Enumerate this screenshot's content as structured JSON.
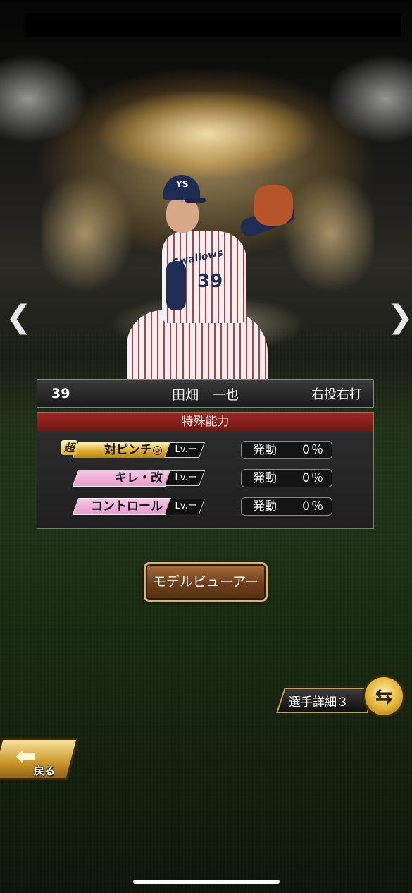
{
  "player": {
    "number": "39",
    "name": "田畑　一也",
    "hand": "右投右打",
    "cap_logo": "YS",
    "jersey_text": "Swallows",
    "jersey_number": "39"
  },
  "abilities": {
    "header": "特殊能力",
    "items": [
      {
        "name": "対ピンチ◎",
        "badge": "超",
        "style": "gold",
        "level": "Lv.ー",
        "activation_label": "発動",
        "activation_value": "0％"
      },
      {
        "name": "キレ・改",
        "badge": "",
        "style": "pink",
        "level": "Lv.ー",
        "activation_label": "発動",
        "activation_value": "0％"
      },
      {
        "name": "コントロール",
        "badge": "",
        "style": "pink",
        "level": "Lv.ー",
        "activation_label": "発動",
        "activation_value": "0％"
      }
    ]
  },
  "buttons": {
    "model_viewer": "モデルビューアー",
    "player_detail": "選手詳細３",
    "back": "戻る"
  },
  "icons": {
    "prev": "chevron-left-icon",
    "next": "chevron-right-icon",
    "cycle": "cycle-icon",
    "back_arrow": "back-arrow-icon"
  },
  "glyphs": {
    "prev": "❮",
    "next": "❯",
    "cycle": "⇆",
    "back_arrow": "⬅"
  }
}
